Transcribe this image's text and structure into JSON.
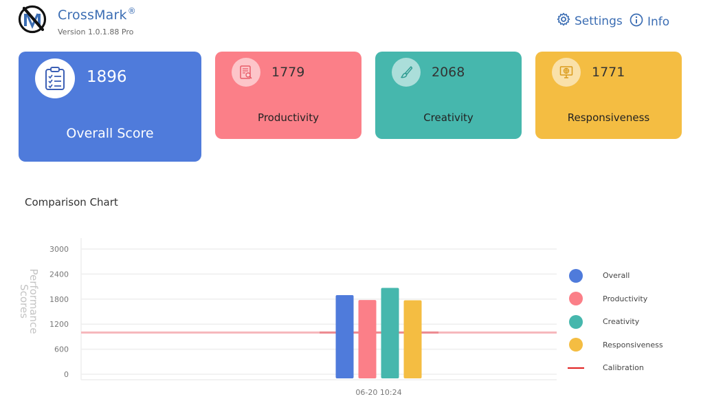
{
  "app": {
    "name": "CrossMark",
    "registered": "®",
    "version": "Version 1.0.1.88 Pro"
  },
  "nav": {
    "settings": {
      "label": "Settings",
      "icon": "gear-icon"
    },
    "info": {
      "label": "Info",
      "icon": "info-icon"
    }
  },
  "cards": {
    "overall": {
      "score": "1896",
      "label": "Overall Score",
      "color": "#4f7bdb",
      "icon": "clipboard-checklist-icon"
    },
    "productivity": {
      "score": "1779",
      "label": "Productivity",
      "color": "#fb7f88",
      "icon": "document-search-icon"
    },
    "creativity": {
      "score": "2068",
      "label": "Creativity",
      "color": "#46b7ad",
      "icon": "paintbrush-icon"
    },
    "responsiveness": {
      "score": "1771",
      "label": "Responsiveness",
      "color": "#f4bd42",
      "icon": "monitor-globe-icon"
    }
  },
  "chart": {
    "section_title": "Comparison Chart"
  },
  "chart_data": {
    "type": "bar",
    "ylabel": "Performance Scores",
    "yticks": [
      0,
      600,
      1200,
      1800,
      2400,
      3000
    ],
    "ylim": [
      0,
      3000
    ],
    "categories": [
      "06-20 10:24"
    ],
    "series": [
      {
        "name": "Overall",
        "values": [
          1896
        ],
        "color": "#4f7bdb"
      },
      {
        "name": "Productivity",
        "values": [
          1779
        ],
        "color": "#fb7f88"
      },
      {
        "name": "Creativity",
        "values": [
          2068
        ],
        "color": "#46b7ad"
      },
      {
        "name": "Responsiveness",
        "values": [
          1771
        ],
        "color": "#f4bd42"
      }
    ],
    "calibration": {
      "name": "Calibration",
      "value": 1000,
      "color": "#e01e1e"
    },
    "grid": true,
    "legend": "right"
  }
}
